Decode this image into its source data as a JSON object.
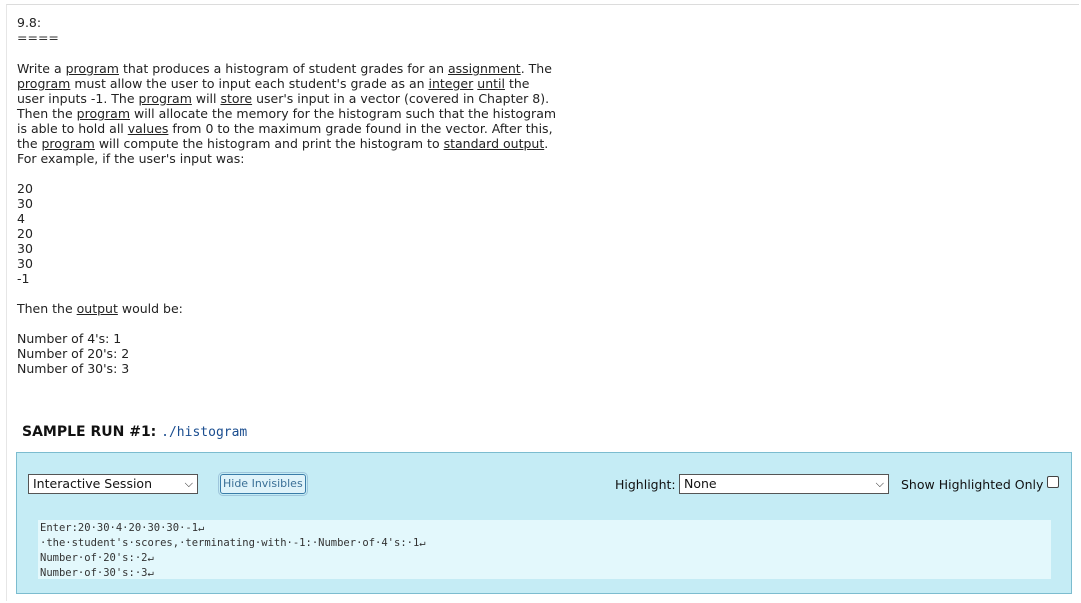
{
  "problem": {
    "title": "9.8:",
    "rule": "====",
    "description": [
      {
        "text": "Write a ",
        "link": false
      },
      {
        "text": "program",
        "link": true
      },
      {
        "text": " that produces a histogram of student grades for an ",
        "link": false
      },
      {
        "text": "assignment",
        "link": true
      },
      {
        "text": ". The ",
        "link": false
      },
      {
        "text": "program",
        "link": true
      },
      {
        "text": " must allow the user to input each student's grade as an ",
        "link": false
      },
      {
        "text": "integer",
        "link": true
      },
      {
        "text": " ",
        "link": false
      },
      {
        "text": "until",
        "link": true
      },
      {
        "text": " the user inputs -1. The ",
        "link": false
      },
      {
        "text": "program",
        "link": true
      },
      {
        "text": " will ",
        "link": false
      },
      {
        "text": "store",
        "link": true
      },
      {
        "text": " user's input in a vector (covered in Chapter 8). Then the ",
        "link": false
      },
      {
        "text": "program",
        "link": true
      },
      {
        "text": " will allocate the memory for the histogram such that the histogram is able to hold all ",
        "link": false
      },
      {
        "text": "values",
        "link": true
      },
      {
        "text": " from 0 to the maximum grade found in the vector. After this, the ",
        "link": false
      },
      {
        "text": "program",
        "link": true
      },
      {
        "text": " will compute the histogram and print the histogram to ",
        "link": false
      },
      {
        "text": "standard output",
        "link": true
      },
      {
        "text": ".",
        "link": false
      }
    ],
    "example_intro": "For example, if the user's input was:",
    "example_input": [
      "20",
      "30",
      "4",
      "20",
      "30",
      "30",
      "-1"
    ],
    "then_prefix": "Then the ",
    "then_link": "output",
    "then_suffix": " would be:",
    "example_output": [
      "Number of 4's: 1",
      "Number of 20's: 2",
      "Number of 30's: 3"
    ]
  },
  "sample_run": {
    "label": "SAMPLE RUN #1:",
    "command": "./histogram"
  },
  "toolbar": {
    "session_select": "Interactive Session",
    "hide_invisibles": "Hide Invisibles",
    "highlight_label": "Highlight:",
    "highlight_select": "None",
    "show_highlighted_label": "Show Highlighted Only",
    "show_highlighted_checked": false
  },
  "terminal": {
    "lines": [
      "Enter:20·30·4·20·30·30·-1↵",
      "·the·student's·scores,·terminating·with·-1:·Number·of·4's:·1↵",
      "Number·of·20's:·2↵",
      "Number·of·30's:·3↵"
    ]
  },
  "colors": {
    "panel_bg": "#c5ecf5",
    "terminal_bg": "#e3f8fc",
    "command_color": "#1a4d8f"
  }
}
